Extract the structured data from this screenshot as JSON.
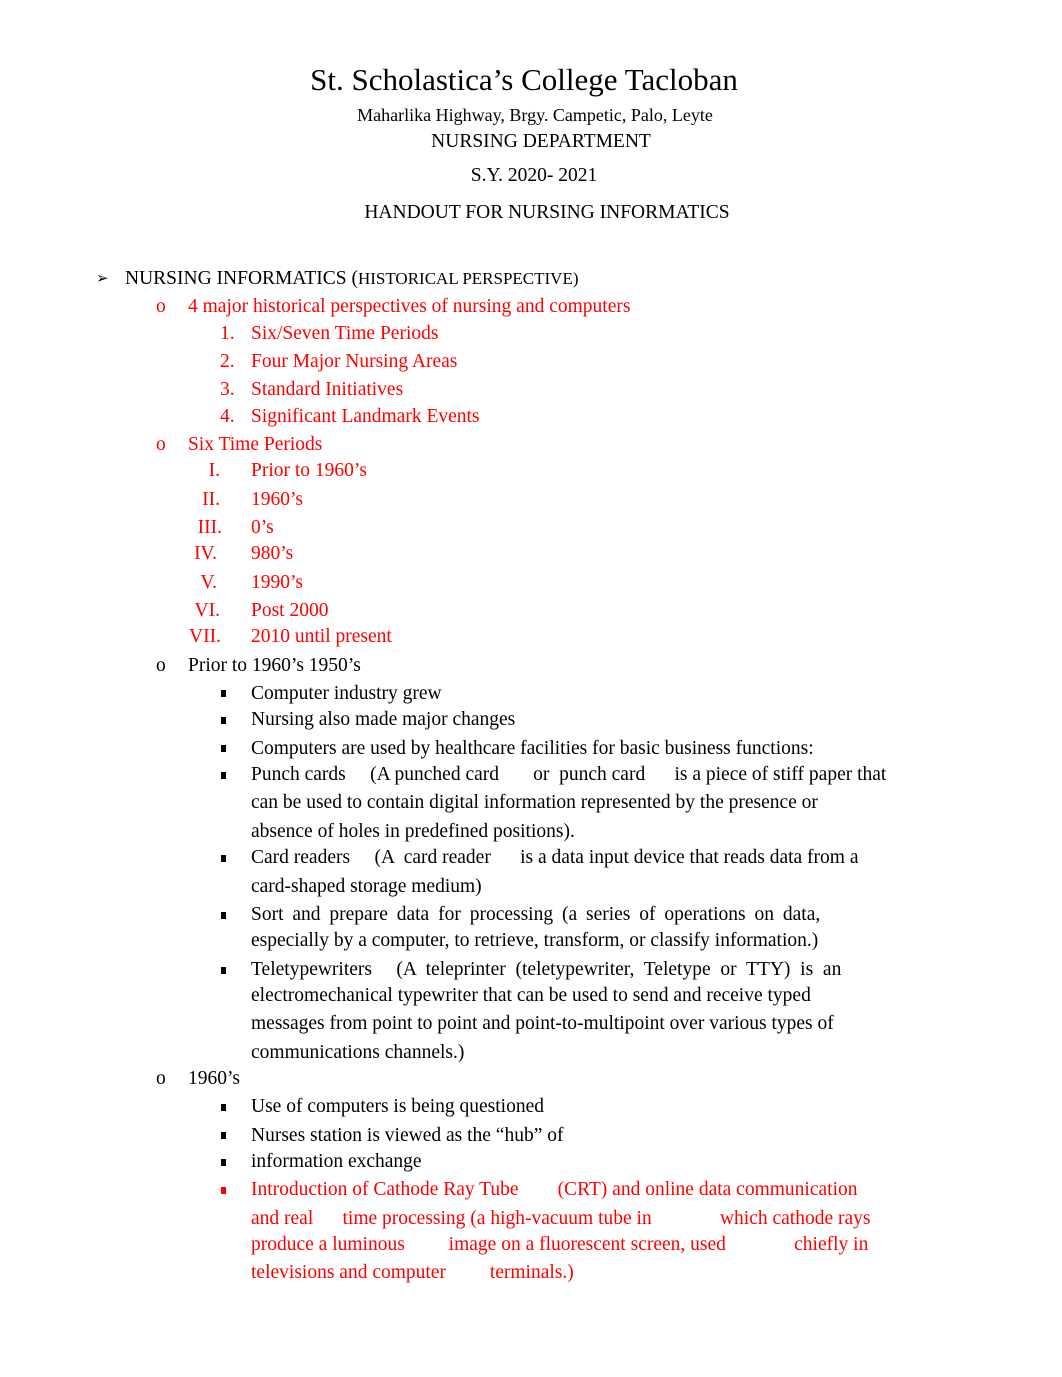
{
  "header": {
    "title": "St. Scholastica’s College Tacloban",
    "address": "Maharlika Highway, Brgy. Campetic, Palo, Leyte",
    "department": "NURSING DEPARTMENT",
    "school_year": "S.Y. 2020- 2021",
    "handout_title": "HANDOUT FOR NURSING INFORMATICS"
  },
  "colors": {
    "accent": "#ff0000",
    "text": "#000000"
  },
  "section": {
    "bullet_icon": "arrowhead-bullet",
    "heading_main": "NURSING INFORMATICS (",
    "heading_sub": "HISTORICAL PERSPECTIVE)",
    "groups": [
      {
        "marker": "o",
        "label": "4 major historical perspectives of nursing and computers",
        "items": [
          {
            "marker": "1.",
            "text": "Six/Seven Time Periods"
          },
          {
            "marker": "2.",
            "text": "Four Major Nursing Areas"
          },
          {
            "marker": "3.",
            "text": "Standard Initiatives"
          },
          {
            "marker": "4.",
            "text": "Significant Landmark Events"
          }
        ]
      },
      {
        "marker": "o",
        "label": "Six Time Periods",
        "items": [
          {
            "marker": "I.",
            "text": "Prior to 1960’s"
          },
          {
            "marker": "II.",
            "text": "1960’s"
          },
          {
            "marker": "III.",
            "text": "0’s"
          },
          {
            "marker": "IV.",
            "text": "980’s"
          },
          {
            "marker": "V.",
            "text": "1990’s"
          },
          {
            "marker": "VI.",
            "text": "Post 2000"
          },
          {
            "marker": "VII.",
            "text": "2010 until present"
          }
        ]
      },
      {
        "marker": "o",
        "label": "Prior to 1960’s 1950’s",
        "items": [
          {
            "lines": [
              "Computer industry grew"
            ]
          },
          {
            "lines": [
              "Nursing also made major changes"
            ]
          },
          {
            "lines": [
              "Computers are used by healthcare facilities for basic business functions:"
            ]
          },
          {
            "lines": [
              "Punch cards     (A punched card       or  punch card      is a piece of stiff paper that",
              "can be used to contain digital information represented by the presence or",
              "absence of holes in predefined positions)."
            ]
          },
          {
            "lines": [
              "Card readers     (A  card reader      is a data input device that reads data from a",
              "card-shaped storage medium)"
            ]
          },
          {
            "lines": [
              "Sort and prepare data for processing (a series of operations on data,",
              "especially by a computer, to retrieve, transform, or classify information.)"
            ]
          },
          {
            "lines": [
              "Teletypewriters     (A  teleprinter  (teletypewriter,  Teletype  or  TTY)  is  an",
              "electromechanical typewriter that can be used to send and receive typed",
              "messages from point to point and point-to-multipoint over various types of",
              "communications channels.)"
            ]
          }
        ]
      },
      {
        "marker": "o",
        "label": "1960’s",
        "items": [
          {
            "lines": [
              "Use of computers is being questioned"
            ]
          },
          {
            "lines": [
              "Nurses station is viewed as the “hub” of"
            ]
          },
          {
            "lines": [
              "information exchange"
            ]
          },
          {
            "lines": [
              "Introduction of Cathode Ray Tube        (CRT) and online data communication",
              "and real      time processing (a high-vacuum tube in              which cathode rays",
              "produce a luminous         image on a fluorescent screen, used              chiefly in",
              "televisions and computer         terminals.)"
            ]
          }
        ]
      }
    ]
  }
}
